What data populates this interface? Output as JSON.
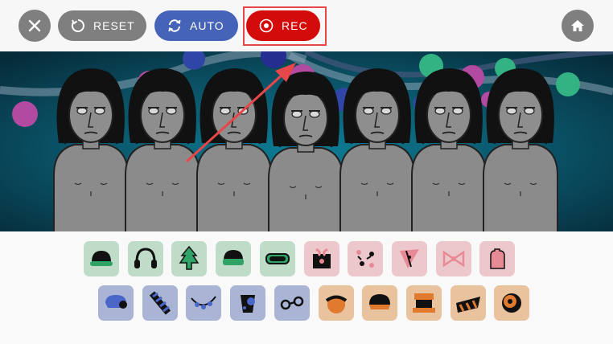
{
  "toolbar": {
    "close_icon": "close-icon",
    "reset_label": "RESET",
    "auto_label": "AUTO",
    "rec_label": "REC",
    "home_icon": "home-icon"
  },
  "colors": {
    "close_bg": "#7f7f7f",
    "reset_bg": "#7f7f7f",
    "auto_bg": "#4564b8",
    "rec_bg": "#d40b0b",
    "highlight": "#e8474a",
    "effects_bg": "#bfdcc9",
    "melodies_bg": "#ecc8cd",
    "beats_bg": "#aab5d6",
    "voices_bg": "#e9c39e"
  },
  "stage": {
    "characters": 7
  },
  "sound_icons": {
    "row1": [
      "helmet-icon",
      "headphones-icon",
      "tree-icon",
      "green-cap-icon",
      "goggles-icon",
      "gift-icon",
      "pink-dots-icon",
      "pink-triangle-icon",
      "bow-icon",
      "pink-hand-icon"
    ],
    "row2": [
      "blue-hat-icon",
      "blue-spiral-icon",
      "blue-lights-icon",
      "blue-cup-icon",
      "blue-glasses-icon",
      "orange-bowler-icon",
      "orange-cap-icon",
      "orange-box-icon",
      "orange-stripe-icon",
      "orange-eye-icon"
    ]
  }
}
